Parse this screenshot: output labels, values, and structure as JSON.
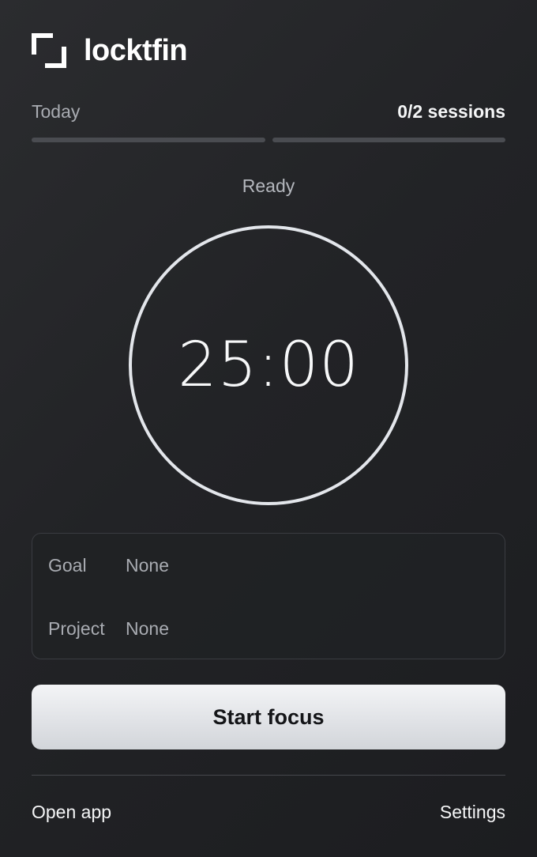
{
  "header": {
    "brand": "locktfin",
    "logo_icon": "bracket-corners-icon"
  },
  "today": {
    "label": "Today",
    "sessions": "0/2 sessions",
    "completed": 0,
    "total": 2
  },
  "timer": {
    "status": "Ready",
    "display": "25:00"
  },
  "details": {
    "goal_label": "Goal",
    "goal_value": "None",
    "project_label": "Project",
    "project_value": "None"
  },
  "actions": {
    "start_label": "Start focus"
  },
  "footer": {
    "open_app": "Open app",
    "settings": "Settings"
  },
  "colors": {
    "background": "#232427",
    "ring": "#e3e6eb",
    "progress_track": "#4a4c51",
    "button": "#e4e6ea"
  }
}
